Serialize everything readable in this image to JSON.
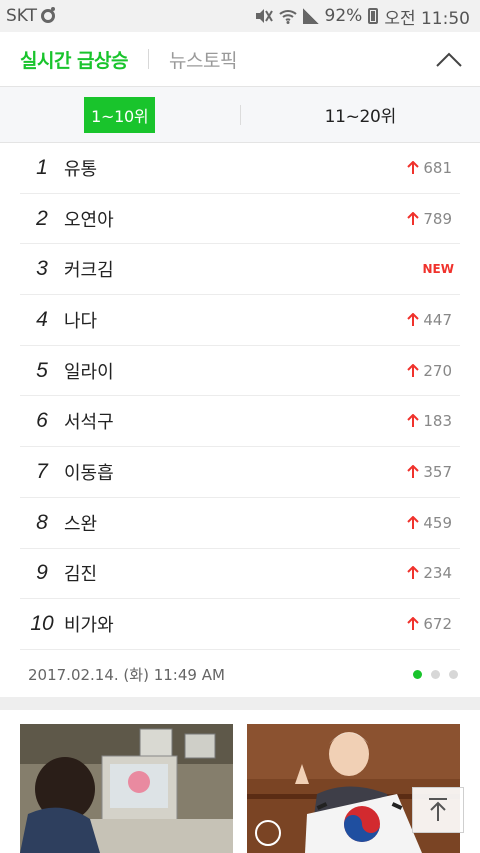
{
  "status_bar": {
    "carrier": "SKT",
    "battery": "92%",
    "time": "오전 11:50"
  },
  "tabs": {
    "realtime": "실시간 급상승",
    "news": "뉴스토픽"
  },
  "range": {
    "active": "1~10위",
    "inactive": "11~20위"
  },
  "rankings": [
    {
      "rank": "1",
      "keyword": "유통",
      "change": "681"
    },
    {
      "rank": "2",
      "keyword": "오연아",
      "change": "789"
    },
    {
      "rank": "3",
      "keyword": "커크김",
      "change": "NEW"
    },
    {
      "rank": "4",
      "keyword": "나다",
      "change": "447"
    },
    {
      "rank": "5",
      "keyword": "일라이",
      "change": "270"
    },
    {
      "rank": "6",
      "keyword": "서석구",
      "change": "183"
    },
    {
      "rank": "7",
      "keyword": "이동흡",
      "change": "357"
    },
    {
      "rank": "8",
      "keyword": "스완",
      "change": "459"
    },
    {
      "rank": "9",
      "keyword": "김진",
      "change": "234"
    },
    {
      "rank": "10",
      "keyword": "비가와",
      "change": "672"
    }
  ],
  "timestamp": "2017.02.14. (화) 11:49 AM",
  "pagination": {
    "total": 3,
    "current": 1
  },
  "colors": {
    "accent": "#19c42c",
    "up": "#f0322c"
  },
  "icons": [
    "chevron-up-icon",
    "arrow-up-icon",
    "scroll-top-icon",
    "image-icon"
  ]
}
